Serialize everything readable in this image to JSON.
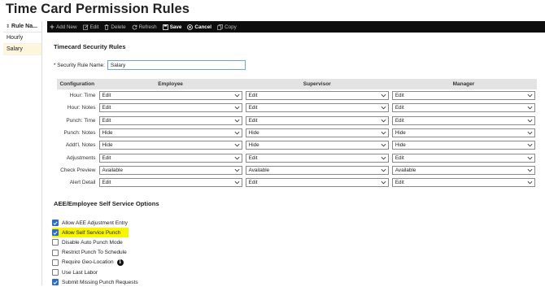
{
  "page_title": "Time Card Permission Rules",
  "sidebar": {
    "header": "Rule Na...",
    "items": [
      {
        "label": "Hourly",
        "active": false
      },
      {
        "label": "Salary",
        "active": true
      }
    ]
  },
  "toolbar": {
    "add_new": "Add New",
    "edit": "Edit",
    "delete": "Delete",
    "refresh": "Refresh",
    "save": "Save",
    "cancel": "Cancel",
    "copy": "Copy"
  },
  "security": {
    "title": "Timecard Security Rules",
    "rule_name_label": "* Security Rule Name:",
    "rule_name_value": "Salary"
  },
  "grid": {
    "headers": [
      "Configuration",
      "Employee",
      "Supervisor",
      "Manager"
    ],
    "rows": [
      {
        "label": "Hour: Time",
        "employee": "Edit",
        "supervisor": "Edit",
        "manager": "Edit"
      },
      {
        "label": "Hour: Notes",
        "employee": "Edit",
        "supervisor": "Edit",
        "manager": "Edit"
      },
      {
        "label": "Punch: Time",
        "employee": "Edit",
        "supervisor": "Edit",
        "manager": "Edit"
      },
      {
        "label": "Punch: Notes",
        "employee": "Hide",
        "supervisor": "Hide",
        "manager": "Hide"
      },
      {
        "label": "Addt'l. Notes",
        "employee": "Hide",
        "supervisor": "Hide",
        "manager": "Hide"
      },
      {
        "label": "Adjustments",
        "employee": "Edit",
        "supervisor": "Edit",
        "manager": "Edit"
      },
      {
        "label": "Check Preview",
        "employee": "Available",
        "supervisor": "Available",
        "manager": "Available"
      },
      {
        "label": "Alert Detail",
        "employee": "Edit",
        "supervisor": "Edit",
        "manager": "Edit"
      }
    ]
  },
  "self_service": {
    "title": "AEE/Employee Self Service Options",
    "options": [
      {
        "label": "Allow AEE Adjustment Entry",
        "checked": true,
        "highlighted": false,
        "info": false
      },
      {
        "label": "Allow Self Service Punch",
        "checked": true,
        "highlighted": true,
        "info": false
      },
      {
        "label": "Disable Auto Punch Mode",
        "checked": false,
        "highlighted": false,
        "info": false
      },
      {
        "label": "Restrict Punch To Schedule",
        "checked": false,
        "highlighted": false,
        "info": false
      },
      {
        "label": "Require Geo-Location",
        "checked": false,
        "highlighted": false,
        "info": true
      },
      {
        "label": "Use Last Labor",
        "checked": false,
        "highlighted": false,
        "info": false
      },
      {
        "label": "Submit Missing Punch Requests",
        "checked": true,
        "highlighted": false,
        "info": false
      }
    ]
  },
  "colors": {
    "toolbar_bg": "#0d0d0d",
    "checkbox_on": "#2b6cd0",
    "highlight": "#f7f500",
    "active_row": "#fdf6dd"
  }
}
